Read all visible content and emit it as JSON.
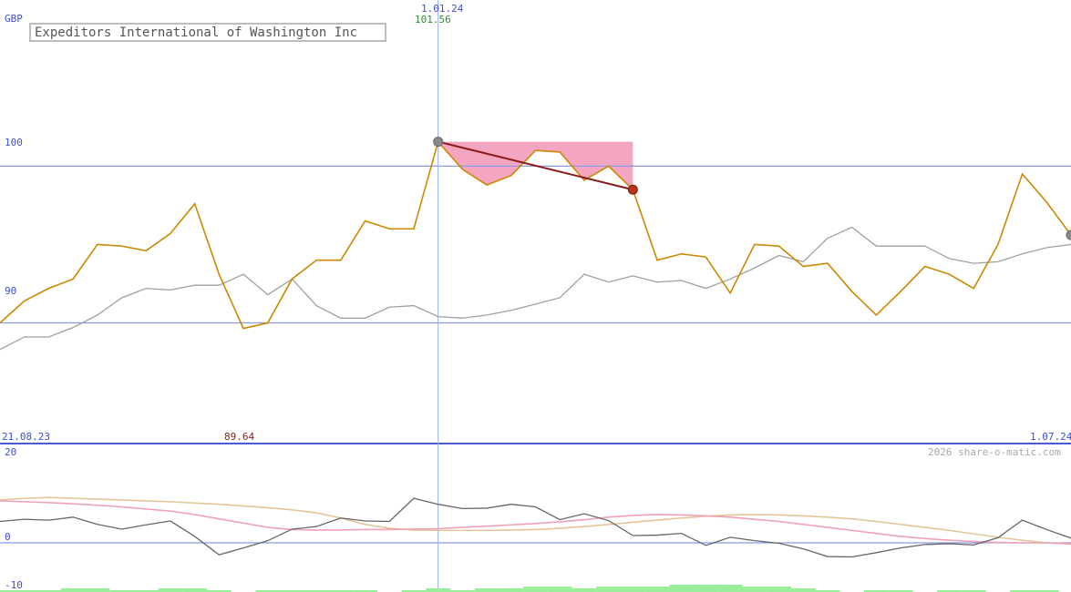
{
  "chart_data": [
    {
      "type": "line",
      "title": "Expeditors International of Washington Inc",
      "currency": "GBP",
      "x_start_label": "21.08.23",
      "x_end_label": "1.07.24",
      "ylim": [
        82.3,
        110.6
      ],
      "y_ticks": [
        90,
        100
      ],
      "grid": true,
      "cursor": {
        "date": "1.01.24",
        "value": "101.56"
      },
      "min_label": "89.64",
      "series": [
        {
          "color": "#cc8800",
          "values": [
            90.0,
            91.4,
            92.2,
            92.8,
            95.0,
            94.9,
            94.6,
            95.7,
            97.6,
            93.1,
            89.64,
            90.0,
            92.8,
            94.0,
            94.0,
            96.5,
            96.0,
            96.0,
            101.56,
            99.8,
            98.8,
            99.4,
            101.0,
            100.9,
            99.1,
            100.0,
            98.5,
            94.0,
            94.4,
            94.2,
            91.9,
            95.0,
            94.9,
            93.6,
            93.8,
            92.0,
            90.5,
            92.0,
            93.6,
            93.1,
            92.2,
            95.0,
            99.5,
            97.7,
            95.6
          ]
        },
        {
          "color": "#a0a0a0",
          "values": [
            88.3,
            89.1,
            89.1,
            89.7,
            90.5,
            91.6,
            92.2,
            92.1,
            92.4,
            92.4,
            93.1,
            91.8,
            92.8,
            91.1,
            90.3,
            90.3,
            91.0,
            91.1,
            90.4,
            90.3,
            90.5,
            90.8,
            91.2,
            91.6,
            93.1,
            92.6,
            93.0,
            92.6,
            92.7,
            92.2,
            92.8,
            93.5,
            94.3,
            93.9,
            95.4,
            96.1,
            94.9,
            94.9,
            94.9,
            94.1,
            93.8,
            93.9,
            94.4,
            94.8,
            95.0
          ]
        }
      ],
      "highlight": {
        "from_index": 18,
        "to_index": 26,
        "start_value": 101.56,
        "end_value": 98.5,
        "color": "#f4a6c0"
      },
      "trend_line_color": "#8b1a1a"
    },
    {
      "type": "line",
      "label_top": "20",
      "label_zero": "0",
      "label_bottom": "-10",
      "ylim": [
        -10,
        20
      ],
      "copyright": "2026 share-o-matic.com",
      "series": [
        {
          "color": "#666666",
          "values": [
            5,
            5.5,
            5.3,
            6,
            4.3,
            3.2,
            4.2,
            5.1,
            1.5,
            -2.8,
            -1.2,
            0.5,
            3.2,
            3.8,
            5.8,
            5.1,
            5,
            10.4,
            9,
            8,
            8.1,
            9,
            8.4,
            5.4,
            6.8,
            5.2,
            1.7,
            1.8,
            2.2,
            -0.6,
            1.3,
            0.5,
            -0.1,
            -1.4,
            -3.2,
            -3.3,
            -2.3,
            -1.2,
            -0.4,
            -0.2,
            -0.5,
            1.2,
            5.3,
            3.1,
            1.1
          ]
        },
        {
          "color": "#f0a0b8",
          "values": [
            9.8,
            9.6,
            9.4,
            9.1,
            8.8,
            8.4,
            7.9,
            7.4,
            6.6,
            5.6,
            4.6,
            3.6,
            3.1,
            3.0,
            3.0,
            3.1,
            3.1,
            3.2,
            3.3,
            3.6,
            3.9,
            4.2,
            4.5,
            4.9,
            5.4,
            6.0,
            6.4,
            6.6,
            6.5,
            6.3,
            6.0,
            5.5,
            5.0,
            4.3,
            3.6,
            2.9,
            2.2,
            1.5,
            1.0,
            0.6,
            0.3,
            0.1,
            0.0,
            0.0,
            -0.2
          ]
        },
        {
          "color": "#e4c696",
          "values": [
            10.0,
            10.4,
            10.6,
            10.4,
            10.2,
            10.0,
            9.8,
            9.6,
            9.3,
            9.0,
            8.6,
            8.2,
            7.7,
            7.0,
            5.8,
            4.3,
            3.4,
            3.0,
            2.9,
            2.9,
            2.9,
            3.0,
            3.1,
            3.4,
            3.8,
            4.3,
            4.8,
            5.3,
            5.8,
            6.2,
            6.5,
            6.6,
            6.5,
            6.3,
            6.0,
            5.6,
            5.0,
            4.3,
            3.6,
            2.9,
            2.1,
            1.3,
            0.6,
            0.0,
            -0.3
          ]
        }
      ],
      "volume": [
        1,
        1,
        1,
        2,
        2,
        1,
        1,
        2,
        2,
        1,
        0,
        1,
        1,
        1,
        1,
        1,
        0,
        1,
        2,
        1,
        2,
        2,
        3,
        3,
        2,
        3,
        3,
        3,
        4,
        4,
        4,
        3,
        3,
        2,
        1,
        0,
        1,
        1,
        0,
        1,
        1,
        0,
        1,
        1,
        0
      ]
    }
  ]
}
